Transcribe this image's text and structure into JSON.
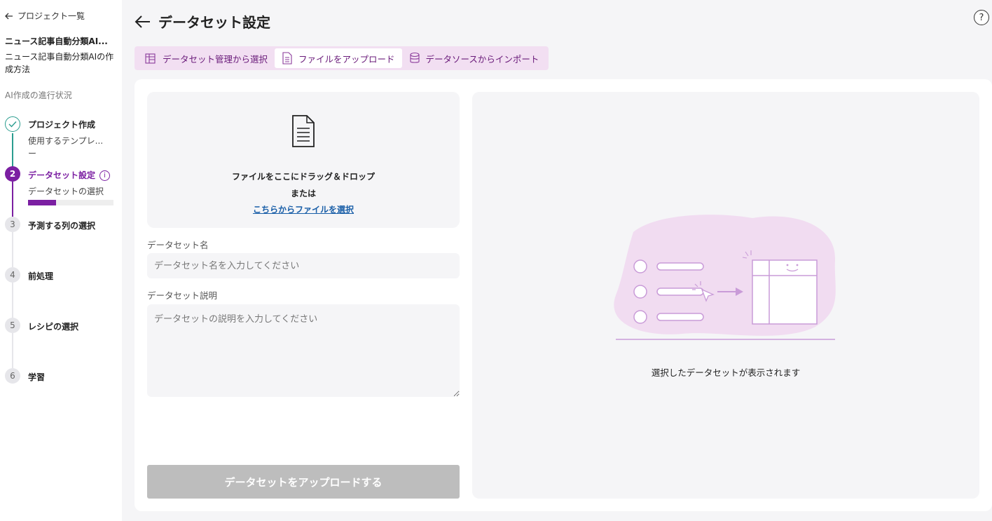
{
  "sidebar": {
    "back_label": "プロジェクト一覧",
    "project_name": "ニュース記事自動分類AI...",
    "project_desc": "ニュース記事自動分類AIの作成方法",
    "progress_title": "AI作成の進行状況",
    "steps": [
      {
        "num": "✓",
        "label": "プロジェクト作成",
        "sub": "使用するテンプレ...",
        "sub2": "ー"
      },
      {
        "num": "2",
        "label": "データセット設定",
        "sub": "データセットの選択",
        "progress": 0.33
      },
      {
        "num": "3",
        "label": "予測する列の選択"
      },
      {
        "num": "4",
        "label": "前処理"
      },
      {
        "num": "5",
        "label": "レシピの選択"
      },
      {
        "num": "6",
        "label": "学習"
      }
    ]
  },
  "header": {
    "title": "データセット設定",
    "help": "?"
  },
  "tabs": [
    {
      "label": "データセット管理から選択",
      "icon": "dataset-table-icon"
    },
    {
      "label": "ファイルをアップロード",
      "icon": "file-icon"
    },
    {
      "label": "データソースからインポート",
      "icon": "database-icon"
    }
  ],
  "upload": {
    "drop_text": "ファイルをここにドラッグ＆ドロップ",
    "or_text": "または",
    "select_link": "こちらからファイルを選択",
    "name_label": "データセット名",
    "name_placeholder": "データセット名を入力してください",
    "desc_label": "データセット説明",
    "desc_placeholder": "データセットの説明を入力してください",
    "submit_label": "データセットをアップロードする"
  },
  "preview": {
    "message": "選択したデータセットが表示されます"
  },
  "colors": {
    "accent": "#7b1fa2",
    "done": "#2a9d8f",
    "tab_bg": "#f2dff2",
    "link": "#1a5fa8",
    "illustration": "#c99bd8"
  }
}
